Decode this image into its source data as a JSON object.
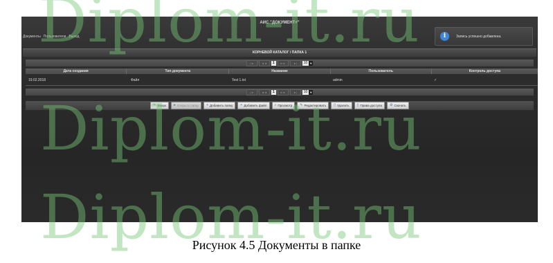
{
  "window": {
    "title": "АИС \"ДОКУМЕНТ+\""
  },
  "menu": {
    "items": [
      "Документы",
      "Пользователи",
      "Выход"
    ]
  },
  "notification": {
    "icon": "info-icon",
    "text": "Запись успешно добавлена."
  },
  "breadcrumb": "КОРНЕВОЙ КАТАЛОГ / ПАПКА 1",
  "pager": {
    "first": "|◄",
    "prev": "◄◄",
    "page": "1",
    "next": "►►",
    "last": "►|",
    "per_page": "10",
    "dropdown_icon": "chevron-down-icon"
  },
  "table": {
    "columns": [
      "Дата создания",
      "Тип документа",
      "Название",
      "Пользователь",
      "Контроль доступа"
    ],
    "rows": [
      {
        "date": "19.02.2018",
        "type": "Файл",
        "name": "Test 1.txt",
        "user": "admin",
        "access": "✓"
      }
    ]
  },
  "toolbar": {
    "buttons": [
      {
        "label": "Вверх",
        "icon": "arrow-up-icon",
        "glyph": "⬑",
        "enabled": true
      },
      {
        "label": "Открыть папку",
        "icon": "folder-open-icon",
        "glyph": "▸",
        "enabled": false
      },
      {
        "label": "Добавить папку",
        "icon": "plus-icon",
        "glyph": "+",
        "enabled": true
      },
      {
        "label": "Добавить файл",
        "icon": "plus-icon",
        "glyph": "+",
        "enabled": true
      },
      {
        "label": "Просмотр",
        "icon": "search-icon",
        "glyph": "⌕",
        "enabled": true
      },
      {
        "label": "Редактировать",
        "icon": "pencil-icon",
        "glyph": "✎",
        "enabled": true
      },
      {
        "label": "Удалить",
        "icon": "trash-icon",
        "glyph": "▯",
        "enabled": true
      },
      {
        "label": "Права доступа",
        "icon": "lock-icon",
        "glyph": "▯",
        "enabled": true
      },
      {
        "label": "Скачать",
        "icon": "gear-icon",
        "glyph": "⚙",
        "enabled": true
      }
    ]
  },
  "watermark": "Diplom-it.ru",
  "caption": "Рисунок 4.5 Документы в папке",
  "colors": {
    "accent": "#3f86d8",
    "watermark": "#78c878",
    "background": "#2e2e2e"
  }
}
